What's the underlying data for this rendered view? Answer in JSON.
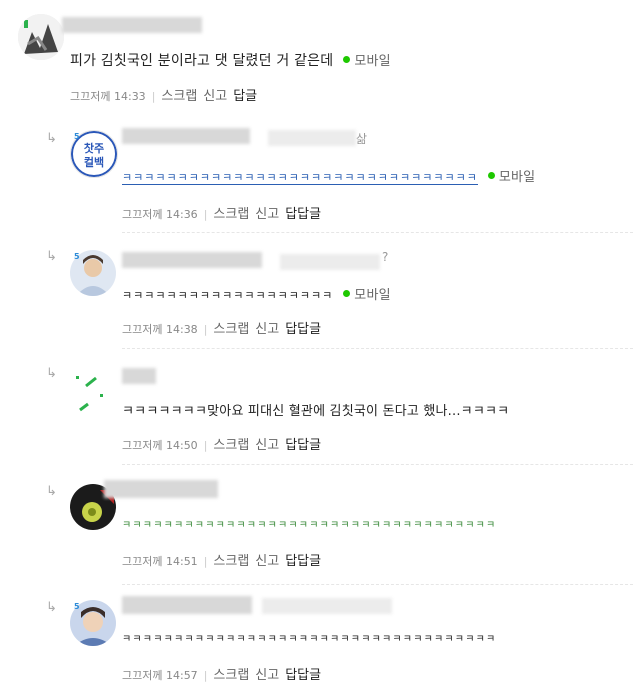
{
  "comments": [
    {
      "text": "피가 김칫국인 분이라고 댓 달렸던 거 같은데",
      "mobile": "모바일",
      "time_prefix": "그끄저께",
      "time": "14:33",
      "scrap": "스크랩",
      "report": "신고",
      "reply": "답글"
    },
    {
      "badge": "5",
      "avatar_text": "찻주컬백",
      "name_tail": "삶",
      "text": "ㅋㅋㅋㅋㅋㅋㅋㅋㅋㅋㅋㅋㅋㅋㅋㅋㅋㅋㅋㅋㅋㅋㅋㅋㅋㅋㅋㅋㅋㅋㅋㅋ",
      "mobile": "모바일",
      "time_prefix": "그끄저께",
      "time": "14:36",
      "scrap": "스크랩",
      "report": "신고",
      "reply": "답답글"
    },
    {
      "badge": "5",
      "name_tail": "?",
      "text": "ㅋㅋㅋㅋㅋㅋㅋㅋㅋㅋㅋㅋㅋㅋㅋㅋㅋㅋㅋ",
      "mobile": "모바일",
      "time_prefix": "그끄저께",
      "time": "14:38",
      "scrap": "스크랩",
      "report": "신고",
      "reply": "답답글"
    },
    {
      "text": "ㅋㅋㅋㅋㅋㅋㅋ맞아요 피대신 혈관에 김칫국이 돈다고 했나...ㅋㅋㅋㅋ",
      "time_prefix": "그끄저께",
      "time": "14:50",
      "scrap": "스크랩",
      "report": "신고",
      "reply": "답답글"
    },
    {
      "text": "ㅋㅋㅋㅋㅋㅋㅋㅋㅋㅋㅋㅋㅋㅋㅋㅋㅋㅋㅋㅋㅋㅋㅋㅋㅋㅋㅋㅋㅋㅋㅋㅋㅋㅋㅋㅋ",
      "time_prefix": "그끄저께",
      "time": "14:51",
      "scrap": "스크랩",
      "report": "신고",
      "reply": "답답글"
    },
    {
      "badge": "5",
      "text": "ㅋㅋㅋㅋㅋㅋㅋㅋㅋㅋㅋㅋㅋㅋㅋㅋㅋㅋㅋㅋㅋㅋㅋㅋㅋㅋㅋㅋㅋㅋㅋㅋㅋㅋㅋㅋ",
      "time_prefix": "그끄저께",
      "time": "14:57",
      "scrap": "스크랩",
      "report": "신고",
      "reply": "답답글"
    }
  ],
  "reply_arrow": "↳",
  "colors": {
    "mobile_dot": "#1ec800",
    "link_blue": "#2b5fb3",
    "green_text": "#3a8a3a"
  }
}
